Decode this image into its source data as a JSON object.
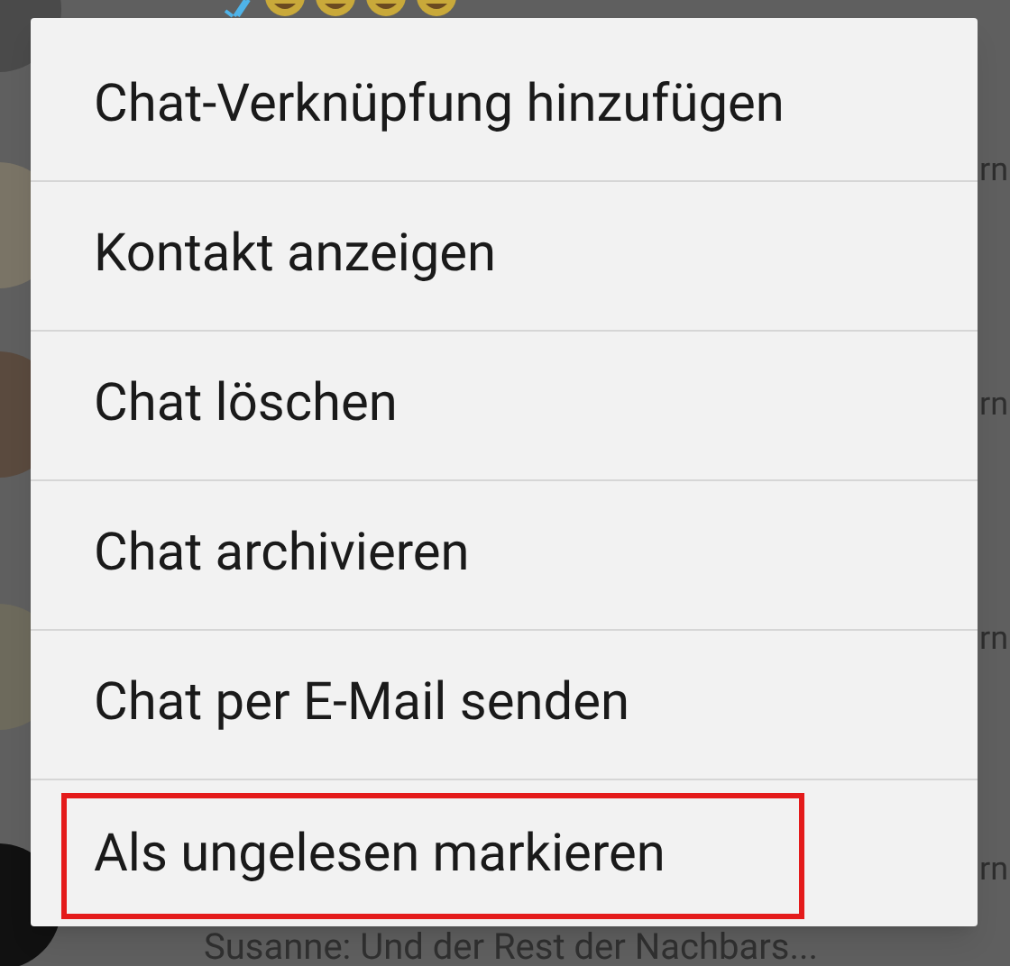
{
  "background": {
    "chats": [
      {
        "time": "rn"
      },
      {
        "time": "rn"
      },
      {
        "time": "rn"
      },
      {
        "time": "rn"
      }
    ],
    "last_preview": "Susanne: Und der Rest der Nachbars..."
  },
  "menu": {
    "items": [
      {
        "label": "Chat-Verknüpfung hinzufügen",
        "highlighted": false
      },
      {
        "label": "Kontakt anzeigen",
        "highlighted": false
      },
      {
        "label": "Chat löschen",
        "highlighted": false
      },
      {
        "label": "Chat archivieren",
        "highlighted": false
      },
      {
        "label": "Chat per E-Mail senden",
        "highlighted": false
      },
      {
        "label": "Als ungelesen markieren",
        "highlighted": true
      }
    ]
  }
}
